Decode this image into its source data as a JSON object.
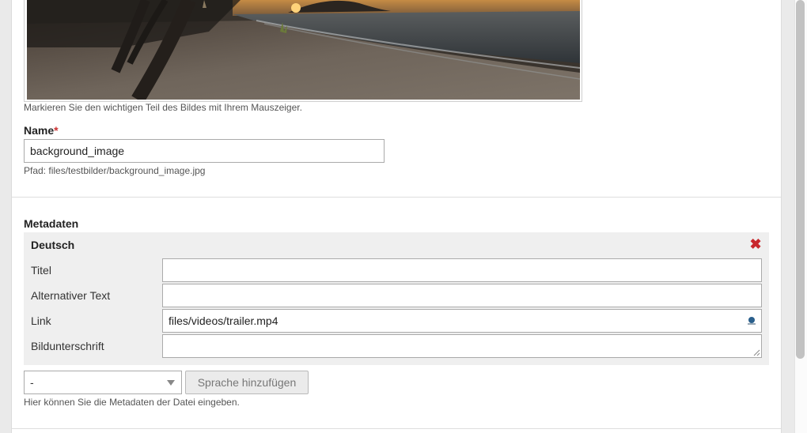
{
  "image": {
    "alt": "beach sunset image preview",
    "hint": "Markieren Sie den wichtigen Teil des Bildes mit Ihrem Mauszeiger."
  },
  "name_field": {
    "label": "Name",
    "required_mark": "*",
    "value": "background_image",
    "path_hint": "Pfad: files/testbilder/background_image.jpg"
  },
  "metadata": {
    "heading": "Metadaten",
    "language_title": "Deutsch",
    "remove_icon": "close-icon",
    "rows": [
      {
        "label": "Titel",
        "value": ""
      },
      {
        "label": "Alternativer Text",
        "value": ""
      },
      {
        "label": "Link",
        "value": "files/videos/trailer.mp4"
      },
      {
        "label": "Bildunterschrift",
        "value": ""
      }
    ],
    "language_select": {
      "selected": "-"
    },
    "add_language_label": "Sprache hinzufügen",
    "hint": "Hier können Sie die Metadaten der Datei eingeben."
  },
  "colors": {
    "remove": "#c8282d",
    "panel": "#ffffff",
    "meta_bg": "#efefef"
  }
}
